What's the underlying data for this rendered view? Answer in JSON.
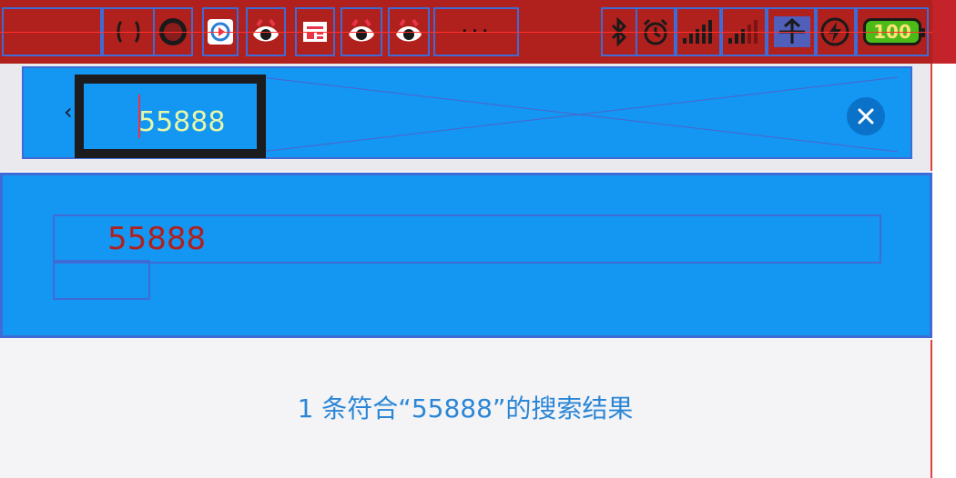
{
  "status_bar": {
    "icons": [
      "notification-icon",
      "app-record-icon",
      "app-play-icon",
      "app-eye-icon",
      "app-news-icon",
      "app-eye-icon",
      "app-eye-icon"
    ],
    "more_label": "···",
    "system_icons": [
      "bluetooth-icon",
      "alarm-icon",
      "signal-icon",
      "signal-icon",
      "wifi-icon",
      "charging-icon"
    ],
    "battery": "100",
    "colors": {
      "background": "#b0201c",
      "battery": "#4cbb17"
    }
  },
  "search": {
    "query": "55888",
    "back_icon": "chevron-left-icon",
    "clear_icon": "close-icon",
    "colors": {
      "bar": "#1496f3",
      "text": "#e6f7a8"
    }
  },
  "suggestion": {
    "text": "55888",
    "colors": {
      "panel": "#1496f3",
      "text": "#b0201c"
    }
  },
  "results": {
    "summary": "1 条符合“55888”的搜索结果",
    "colors": {
      "text": "#2b86d6"
    }
  }
}
